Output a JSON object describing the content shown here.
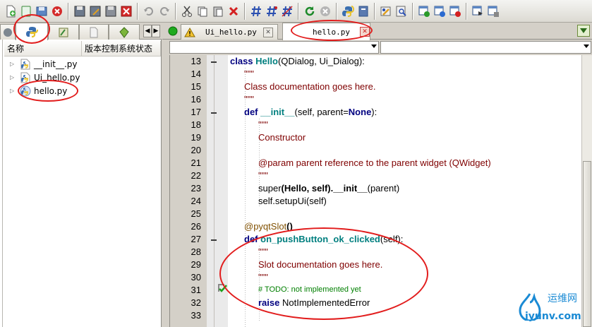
{
  "toolbar": {
    "icons": [
      "new-file-icon",
      "new-file-green-icon",
      "save-icon",
      "close-red-icon",
      "save-disk-icon",
      "save-as-icon",
      "save-all-icon",
      "close-window-icon",
      "undo-icon",
      "redo-icon",
      "cut-icon",
      "copy-icon",
      "paste-icon",
      "delete-icon",
      "hash-icon",
      "hash-star-icon",
      "hash-slash-icon",
      "refresh-icon",
      "stop-icon",
      "python-icon",
      "book-icon",
      "debug-icon",
      "inspect-icon",
      "add-window-icon",
      "window-dots-icon",
      "window-remove-icon",
      "window-back-icon",
      "window-extra-icon"
    ]
  },
  "left_panel": {
    "columns": [
      "名称",
      "版本控制系统状态"
    ],
    "files": [
      "__init__.py",
      "Ui_hello.py",
      "hello.py"
    ]
  },
  "editor_tabs": [
    {
      "label": "Ui_hello.py",
      "icon": "warning-icon"
    },
    {
      "label": "hello.py",
      "icon": ""
    }
  ],
  "code_lines": [
    {
      "num": "13"
    },
    {
      "num": "14",
      "text": "\"\"\""
    },
    {
      "num": "15",
      "text": "Class documentation goes here."
    },
    {
      "num": "16",
      "text": "\"\"\""
    },
    {
      "num": "17"
    },
    {
      "num": "18",
      "text": "\"\"\""
    },
    {
      "num": "19",
      "text": "Constructor"
    },
    {
      "num": "20",
      "text": ""
    },
    {
      "num": "21",
      "text": "@param parent reference to the parent widget (QWidget)"
    },
    {
      "num": "22",
      "text": "\"\"\""
    },
    {
      "num": "23"
    },
    {
      "num": "24"
    },
    {
      "num": "25",
      "text": ""
    },
    {
      "num": "26"
    },
    {
      "num": "27"
    },
    {
      "num": "28",
      "text": "\"\"\""
    },
    {
      "num": "29",
      "text": "Slot documentation goes here."
    },
    {
      "num": "30",
      "text": "\"\"\""
    },
    {
      "num": "31",
      "text": "# TODO: not implemented yet"
    },
    {
      "num": "32"
    },
    {
      "num": "33",
      "text": ""
    }
  ],
  "code_tokens": {
    "l13": [
      "class",
      "Hello",
      "(QDialog, Ui_Dialog):"
    ],
    "l17": [
      "def",
      "__init__",
      "(self, parent=",
      "None",
      "):"
    ],
    "l23": [
      "super",
      "(Hello, self).__init__",
      "(parent)"
    ],
    "l24": [
      "self.setupUi",
      "(self)"
    ],
    "l26": [
      "@pyqtSlot",
      "()"
    ],
    "l27": [
      "def",
      "on_pushButton_ok_clicked",
      "(self):"
    ],
    "l32": [
      "raise",
      "NotImplementedError"
    ]
  },
  "watermark": {
    "brand": "运维网",
    "url": "iyunv.com"
  },
  "colors": {
    "annotation": "#e21d1d",
    "keyword": "#000080",
    "function": "#007f7f",
    "string": "#7f0000",
    "comment": "#007f00",
    "decorator": "#805000"
  }
}
